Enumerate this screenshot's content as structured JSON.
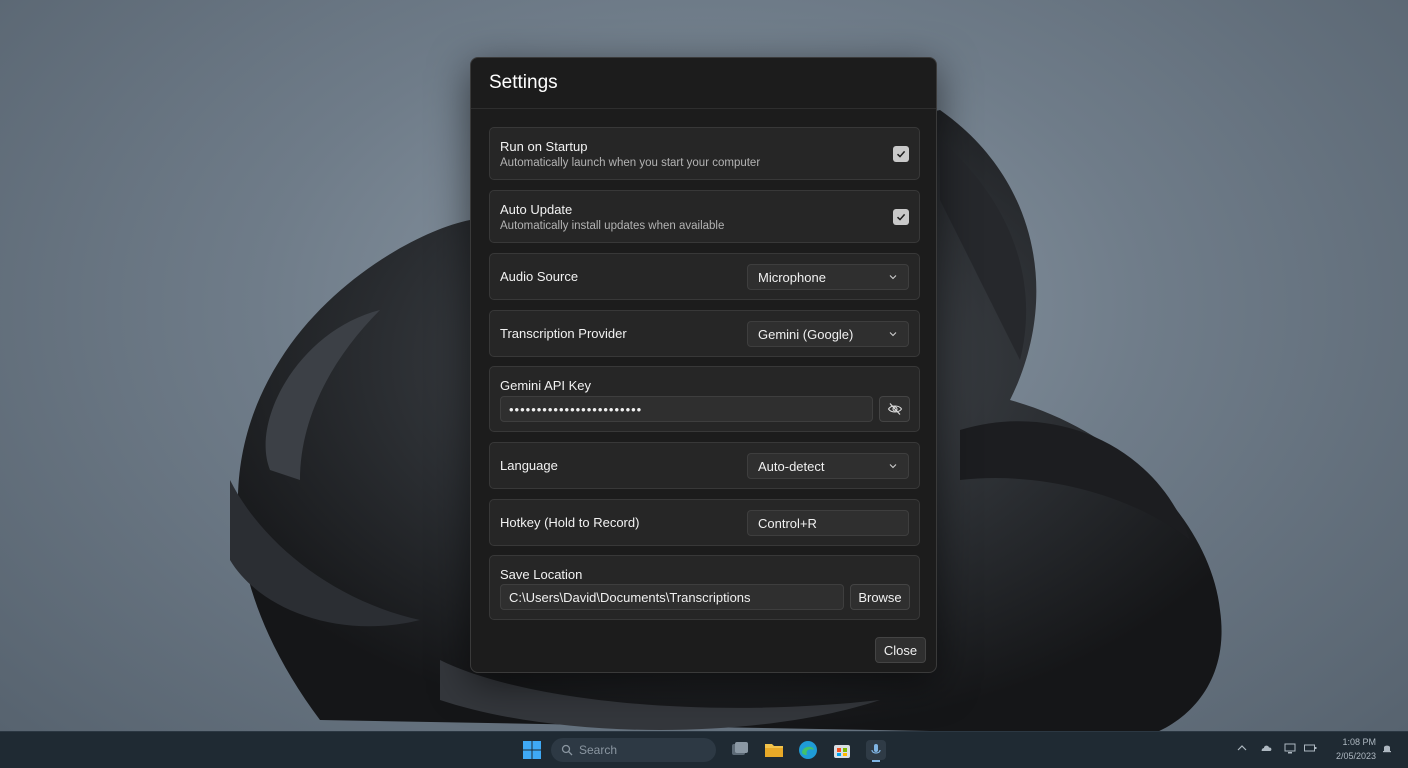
{
  "dialog": {
    "title": "Settings",
    "run_on_startup": {
      "title": "Run on Startup",
      "description": "Automatically launch when you start your computer",
      "checked": true
    },
    "auto_update": {
      "title": "Auto Update",
      "description": "Automatically install updates when available",
      "checked": true
    },
    "audio_source": {
      "label": "Audio Source",
      "value": "Microphone"
    },
    "transcription_provider": {
      "label": "Transcription Provider",
      "value": "Gemini (Google)"
    },
    "api_key": {
      "label": "Gemini API Key",
      "value": "••••••••••••••••••••••••"
    },
    "language": {
      "label": "Language",
      "value": "Auto-detect"
    },
    "hotkey": {
      "label": "Hotkey (Hold to Record)",
      "value": "Control+R"
    },
    "save_location": {
      "label": "Save Location",
      "value": "C:\\Users\\David\\Documents\\Transcriptions",
      "browse_label": "Browse"
    },
    "close_label": "Close"
  },
  "taskbar": {
    "search_placeholder": "Search",
    "clock_time": "1:08 PM",
    "clock_date": "2/05/2023"
  },
  "colors": {
    "dialog_bg": "#1c1c1c",
    "card_bg": "#262626",
    "checkbox_fill": "#c9c9c9",
    "taskbar_bg": "#1f2a33"
  },
  "icons": [
    "checkmark-icon",
    "chevron-down-icon",
    "eye-hidden-icon",
    "windows-start-icon",
    "search-icon",
    "task-view-icon",
    "file-explorer-icon",
    "edge-icon",
    "store-icon",
    "app-icon",
    "chevron-up-icon",
    "cloud-icon",
    "network-icon",
    "battery-icon",
    "notification-bell-icon"
  ]
}
